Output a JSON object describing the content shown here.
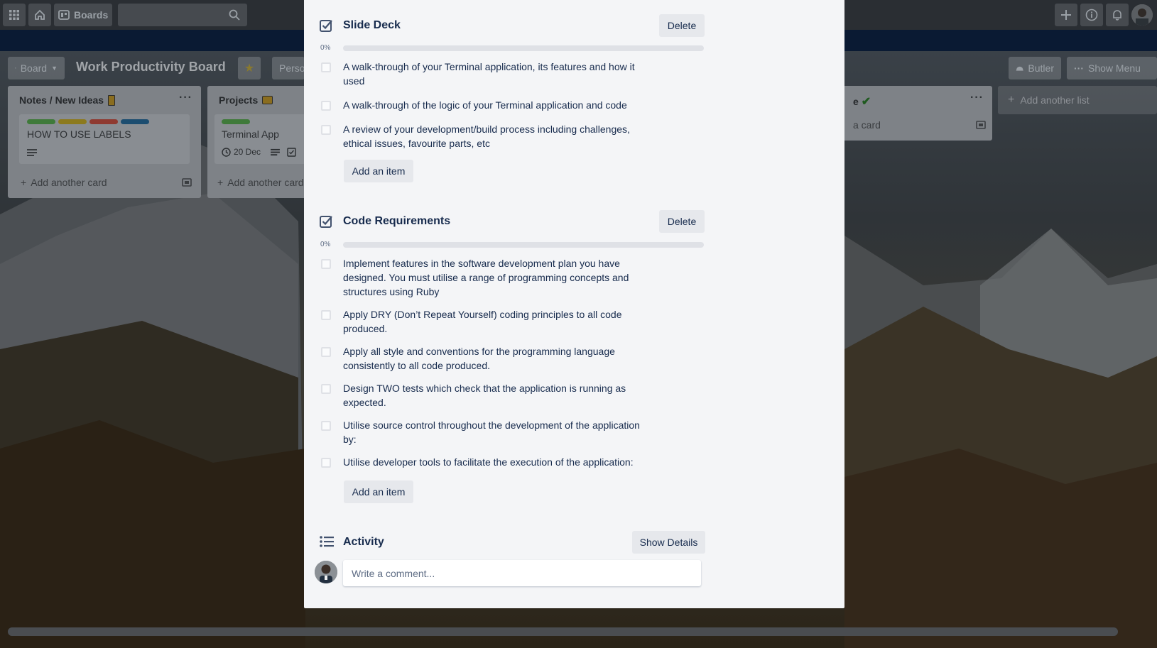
{
  "header": {
    "boards_label": "Boards",
    "icons": [
      "apps-grid-icon",
      "home-icon",
      "boards-icon",
      "search-icon",
      "plus-icon",
      "info-icon",
      "bell-icon",
      "avatar"
    ]
  },
  "board": {
    "view_label": "Board",
    "title": "Work Productivity Board",
    "visibility_label": "Perso",
    "butler_label": "Butler",
    "show_menu_label": "Show Menu",
    "add_list_label": "Add another list"
  },
  "lists": [
    {
      "title": "Notes / New Ideas",
      "cards": [
        {
          "title": "HOW TO USE LABELS",
          "labels": [
            "#61bd4f",
            "#f2d600",
            "#eb5a46",
            "#0079bf"
          ]
        }
      ],
      "add_card_label": "Add another card"
    },
    {
      "title": "Projects",
      "cards": [
        {
          "title": "Terminal App",
          "due": "20 Dec",
          "labels": [
            "#61bd4f"
          ]
        }
      ],
      "add_card_label": "Add another card"
    },
    {
      "title_fragment": "e",
      "cards": [
        {
          "title_fragment": "a card"
        }
      ]
    }
  ],
  "modal": {
    "checklists": [
      {
        "title": "Slide Deck",
        "delete_label": "Delete",
        "progress_text": "0%",
        "progress": 0,
        "items": [
          "A walk-through of your Terminal application, its features and how it used",
          "A walk-through of the logic of your Terminal application and code",
          "A review of your development/build process including challenges, ethical issues, favourite parts, etc"
        ],
        "add_item_label": "Add an item"
      },
      {
        "title": "Code Requirements",
        "delete_label": "Delete",
        "progress_text": "0%",
        "progress": 0,
        "items": [
          "Implement features in the software development plan you have designed. You must utilise a range of programming concepts and structures using Ruby",
          "Apply DRY (Don’t Repeat Yourself) coding principles to all code produced.",
          "Apply all style and conventions for the programming language consistently to all code produced.",
          "Design TWO tests which check that the application is running as expected.",
          "Utilise source control throughout the development of the application by:",
          "Utilise developer tools to facilitate the execution of the application:"
        ],
        "add_item_label": "Add an item"
      }
    ],
    "activity": {
      "title": "Activity",
      "show_details_label": "Show Details",
      "comment_placeholder": "Write a comment..."
    }
  },
  "colors": {
    "progress_fill": "#5aac44",
    "modal_bg": "#f4f5f7",
    "text": "#172b4d"
  }
}
